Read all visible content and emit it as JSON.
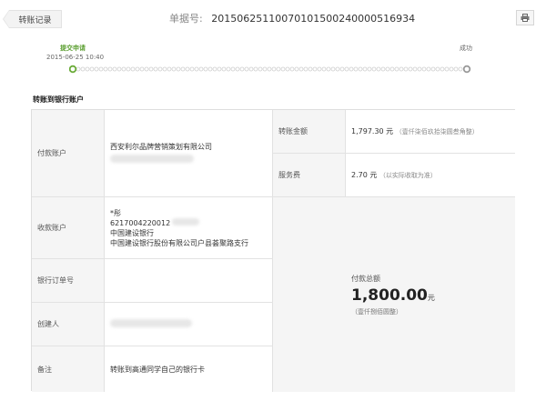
{
  "header": {
    "back_label": "转账记录",
    "doc_label": "单据号:",
    "doc_number": "20150625110070101500240000516934",
    "print_icon": "printer-icon"
  },
  "progress": {
    "start_label": "提交申请",
    "start_time": "2015-06-25 10:40",
    "end_label": "成功",
    "accent_color": "#6aab38"
  },
  "section": {
    "title": "转账到银行账户"
  },
  "payer": {
    "label": "付款账户",
    "name": "西安利尔品牌营销策划有限公司"
  },
  "payee": {
    "label": "收款账户",
    "name": "*彤",
    "account": "6217004220012",
    "bank": "中国建设银行",
    "branch": "中国建设银行股份有限公司户县荟聚路支行"
  },
  "order": {
    "label": "银行订单号",
    "value": ""
  },
  "creator": {
    "label": "创建人"
  },
  "remark": {
    "label": "备注",
    "value": "转账到高通同学自己的银行卡"
  },
  "amount": {
    "label": "转账金额",
    "value": "1,797.30",
    "unit": "元",
    "words": "（壹仟柒佰玖拾柒圆叁角整）"
  },
  "fee": {
    "label": "服务费",
    "value": "2.70",
    "unit": "元",
    "note": "（以实际收取为准）"
  },
  "total": {
    "label": "付款总额",
    "value": "1,800.00",
    "unit": "元",
    "words": "（壹仟捌佰圆整）"
  }
}
